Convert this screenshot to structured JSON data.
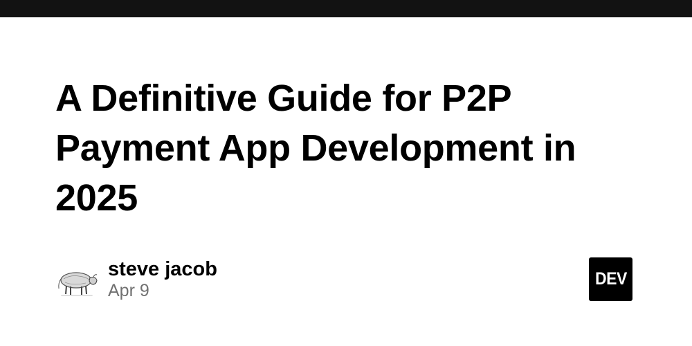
{
  "post": {
    "title": "A Definitive Guide for P2P Payment App Development in 2025"
  },
  "author": {
    "name": "steve jacob",
    "date": "Apr 9",
    "avatar_icon": "bull-illustration-icon"
  },
  "brand": {
    "logo_text": "DEV",
    "top_bar_color": "#121212",
    "logo_bg": "#000000",
    "date_color": "#717171"
  }
}
